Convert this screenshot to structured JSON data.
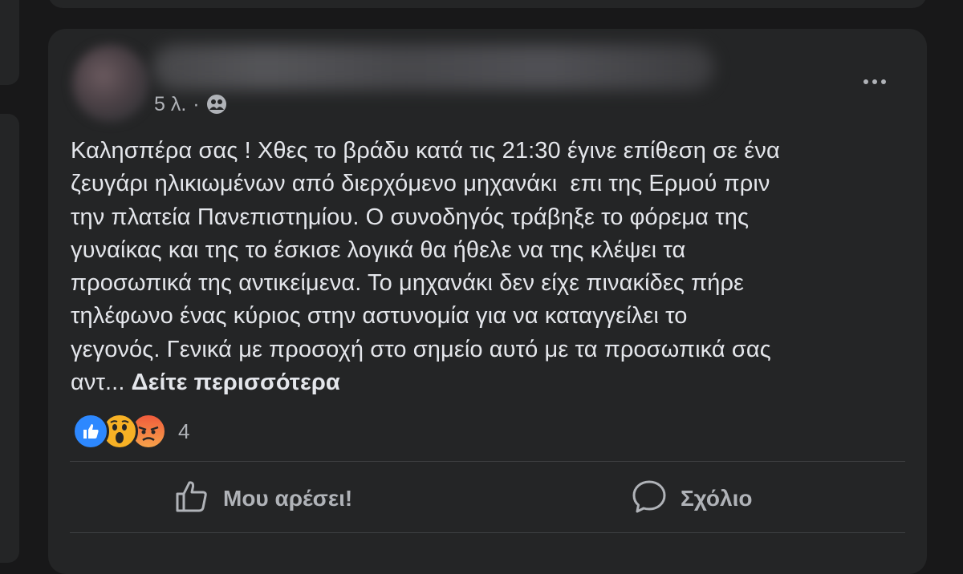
{
  "post": {
    "author_name": "",
    "timestamp": "5 λ.",
    "separator": "·",
    "privacy_icon": "friends-icon",
    "text_lines": [
      "Καλησπέρα σας ! Χθες το βράδυ κατά τις 21:30 έγινε επίθεση σε ένα",
      "ζευγάρι ηλικιωμένων από διερχόμενο μηχανάκι  επι της Ερμού πριν",
      "την πλατεία Πανεπιστημίου. Ο συνοδηγός τράβηξε το φόρεμα της",
      "γυναίκας και της το έσκισε λογικά θα ήθελε να της κλέψει τα",
      "προσωπικά της αντικείμενα. Το μηχανάκι δεν είχε πινακίδες πήρε",
      "τηλέφωνο ένας κύριος στην αστυνομία για να καταγγείλει το",
      "γεγονός. Γενικά με προσοχή στο σημείο αυτό με τα προσωπικά σας"
    ],
    "last_line": "αντ... ",
    "see_more_label": "Δείτε περισσότερα"
  },
  "reactions": {
    "types": [
      "like",
      "wow",
      "angry"
    ],
    "count": "4"
  },
  "actions": {
    "like_label": "Μου αρέσει!",
    "comment_label": "Σχόλιο"
  },
  "colors": {
    "background": "#181819",
    "card": "#242526",
    "text_primary": "#e4e6eb",
    "text_secondary": "#b0b3b8",
    "like_blue": "#2d88ff",
    "wow_yellow": "#f7b125",
    "angry_red": "#f05b3c"
  }
}
